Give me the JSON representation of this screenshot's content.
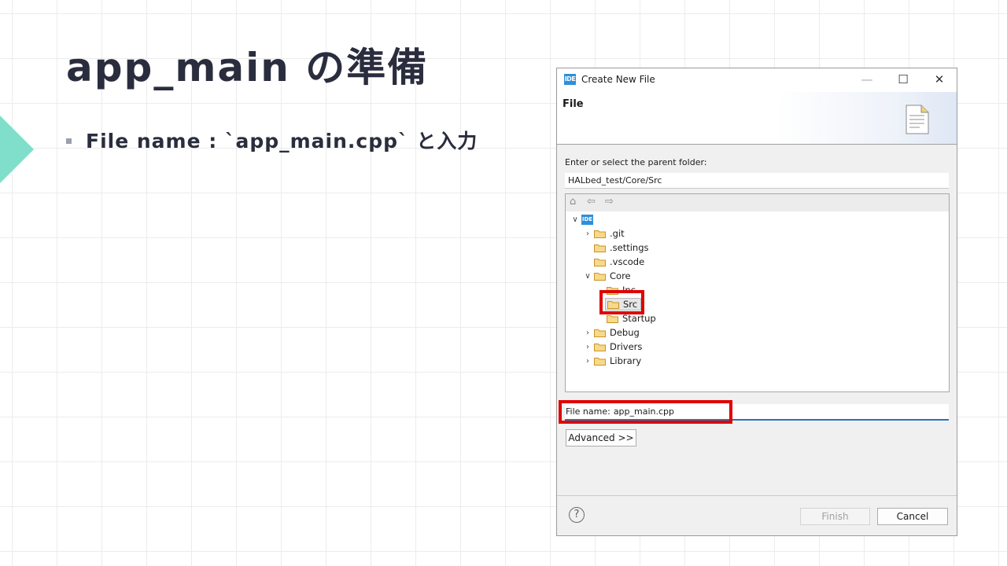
{
  "slide": {
    "title": "app_main の準備",
    "bullet": "File name : `app_main.cpp` と入力"
  },
  "dialog": {
    "window_title": "Create New File",
    "app_icon_text": "IDE",
    "banner_title": "File",
    "parent_folder_label": "Enter or select the parent folder:",
    "parent_folder_value": "HALbed_test/Core/Src",
    "tree": {
      "root_icon_text": "IDE",
      "items": [
        {
          "label": ".git",
          "expander": "collapsed"
        },
        {
          "label": ".settings",
          "expander": "none"
        },
        {
          "label": ".vscode",
          "expander": "none"
        },
        {
          "label": "Core",
          "expander": "expanded"
        },
        {
          "label": "Inc",
          "expander": "none"
        },
        {
          "label": "Src",
          "expander": "none",
          "selected": true
        },
        {
          "label": "Startup",
          "expander": "none"
        },
        {
          "label": "Debug",
          "expander": "collapsed"
        },
        {
          "label": "Drivers",
          "expander": "collapsed"
        },
        {
          "label": "Library",
          "expander": "collapsed"
        }
      ]
    },
    "file_name_label": "File name:",
    "file_name_value": "app_main.cpp",
    "advanced_button": "Advanced >>",
    "finish_button": "Finish",
    "cancel_button": "Cancel",
    "help_glyph": "?"
  },
  "colors": {
    "accent": "#7fdfca",
    "highlight": "#e00000",
    "title_text": "#2a2d3d",
    "ide_blue": "#2f8fd8",
    "folder": "#e8b84a"
  }
}
